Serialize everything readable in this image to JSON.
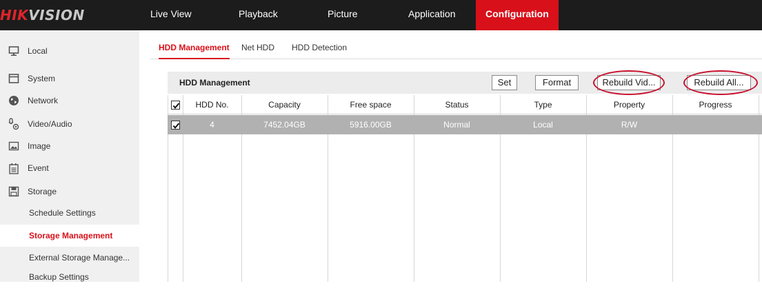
{
  "brand": {
    "logo_accent": "HIK",
    "logo_rest": "VISION"
  },
  "topnav": {
    "items": [
      "Live View",
      "Playback",
      "Picture",
      "Application",
      "Configuration"
    ],
    "active": "Configuration"
  },
  "sidebar": {
    "items": [
      {
        "label": "Local",
        "icon": "monitor-icon"
      },
      {
        "label": "System",
        "icon": "window-icon"
      },
      {
        "label": "Network",
        "icon": "globe-icon"
      },
      {
        "label": "Video/Audio",
        "icon": "microphone-camera-icon"
      },
      {
        "label": "Image",
        "icon": "image-icon"
      },
      {
        "label": "Event",
        "icon": "calendar-icon"
      },
      {
        "label": "Storage",
        "icon": "floppy-disk-icon"
      }
    ],
    "sub_items": [
      "Schedule Settings",
      "Storage Management",
      "External Storage Manage...",
      "Backup Settings"
    ],
    "current": "Storage Management"
  },
  "tabs": {
    "items": [
      "HDD Management",
      "Net HDD",
      "HDD Detection"
    ],
    "active": "HDD Management"
  },
  "panel": {
    "title": "HDD Management",
    "buttons": {
      "set": "Set",
      "format": "Format",
      "rebuild_video": "Rebuild Vid...",
      "rebuild_all": "Rebuild All..."
    }
  },
  "table": {
    "columns": [
      "HDD No.",
      "Capacity",
      "Free space",
      "Status",
      "Type",
      "Property",
      "Progress"
    ],
    "header_checked": true,
    "rows": [
      {
        "checked": true,
        "cells": [
          "4",
          "7452.04GB",
          "5916.00GB",
          "Normal",
          "Local",
          "R/W",
          ""
        ]
      }
    ]
  },
  "colors": {
    "accent": "#d8101a",
    "topbar": "#1c1c1c",
    "sidebar": "#f0f0f0",
    "selected_row": "#b1b1b1",
    "highlight_ring": "#c8102e"
  }
}
